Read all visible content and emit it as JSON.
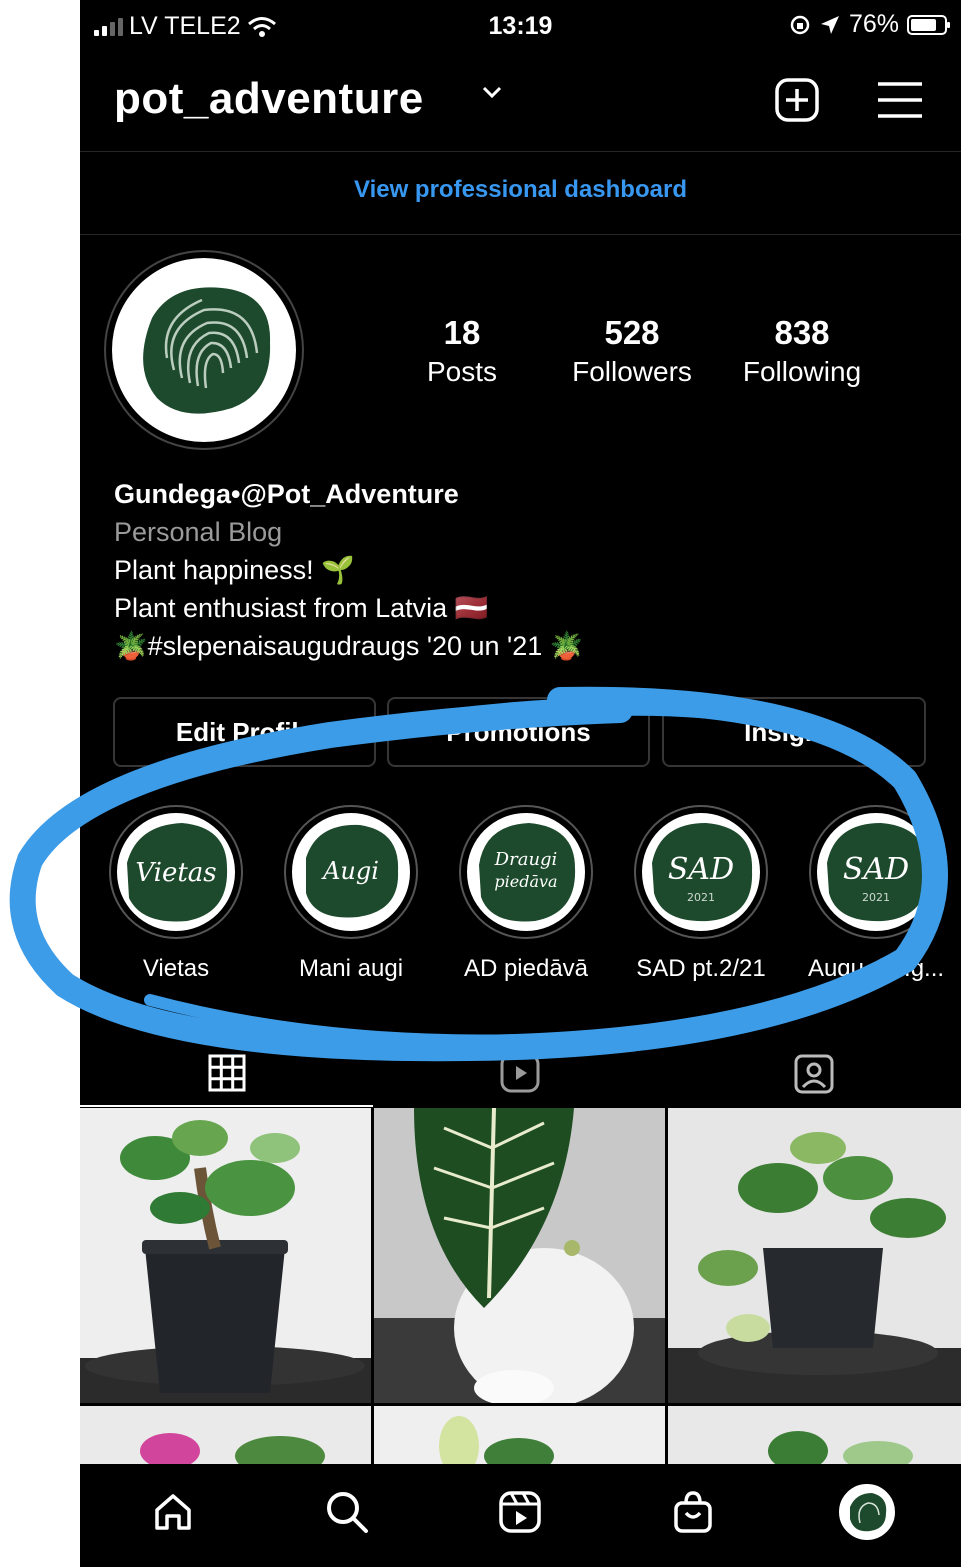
{
  "status_bar": {
    "carrier": "LV TELE2",
    "time": "13:19",
    "battery_percent": "76%",
    "battery_level": 0.76
  },
  "header": {
    "username": "pot_adventure",
    "icons": [
      "chevron-down-icon",
      "add-icon",
      "menu-icon"
    ]
  },
  "dashboard_link": "View professional dashboard",
  "profile": {
    "stats": [
      {
        "value": "18",
        "label": "Posts"
      },
      {
        "value": "528",
        "label": "Followers"
      },
      {
        "value": "838",
        "label": "Following"
      }
    ],
    "name_line": "Gundega•@Pot_Adventure",
    "category": "Personal Blog",
    "bio_lines": [
      "Plant happiness! 🌱",
      "Plant enthusiast from Latvia 🇱🇻",
      "🪴#slepenaisaugudraugs  '20 un '21 🪴"
    ]
  },
  "buttons": {
    "edit_profile": "Edit Profile",
    "promotions": "Promotions",
    "insights": "Insights"
  },
  "highlights": [
    {
      "label": "Vietas",
      "cover_text": "Vietas",
      "cover_sub": ""
    },
    {
      "label": "Mani augi",
      "cover_text": "Augi",
      "cover_sub": ""
    },
    {
      "label": "AD piedāvā",
      "cover_text": "Draugi piedāva",
      "cover_sub": ""
    },
    {
      "label": "SAD pt.2/21",
      "cover_text": "SAD",
      "cover_sub": "2021"
    },
    {
      "label": "Augu dr...g...",
      "cover_text": "SAD",
      "cover_sub": "2021"
    }
  ],
  "tabs": [
    "grid-icon",
    "reels-icon",
    "tagged-icon"
  ],
  "colors": {
    "accent_blue": "#3897f0",
    "annotation_blue": "#3d9ce8",
    "plant_green": "#1d4a2c"
  },
  "bottom_nav": [
    "home-icon",
    "search-icon",
    "reels-icon",
    "shop-icon",
    "profile-avatar"
  ]
}
